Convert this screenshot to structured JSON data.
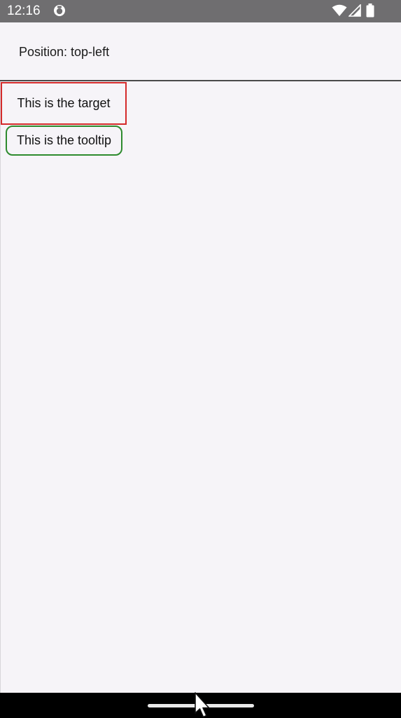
{
  "status_bar": {
    "time": "12:16",
    "app_icon": "sync-circle-icon",
    "wifi_icon": "wifi-icon",
    "signal_icon": "cellular-signal-icon",
    "battery_icon": "battery-icon"
  },
  "header": {
    "title": "Position: top-left"
  },
  "target": {
    "label": "This is the target",
    "border_color": "#d42a2a"
  },
  "tooltip": {
    "label": "This is the tooltip",
    "border_color": "#2e8b2e"
  },
  "navigation": {
    "home_handle": "home-handle",
    "cursor": "mouse-cursor-icon"
  }
}
